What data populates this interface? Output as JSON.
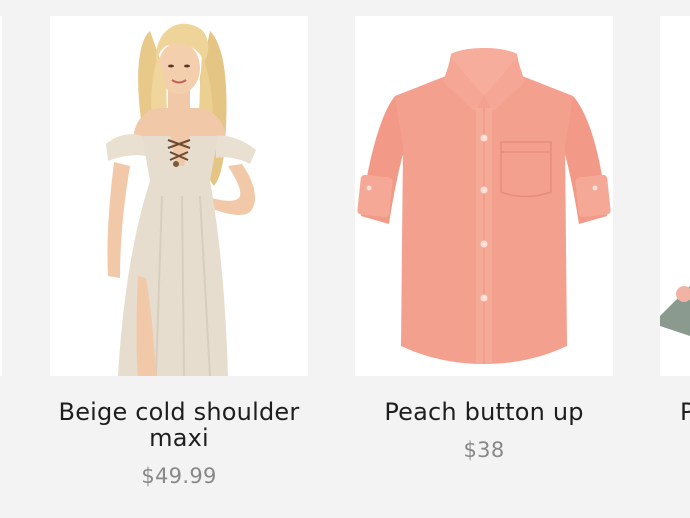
{
  "products": [
    {
      "title": "Beige cold shoulder maxi",
      "price": "$49.99",
      "image_icon": "beige-dress-photo"
    },
    {
      "title": "Peach button up",
      "price": "$38",
      "image_icon": "peach-shirt-photo"
    },
    {
      "title": "P",
      "image_icon": "partial-product-photo"
    }
  ],
  "colors": {
    "page_background": "#f3f3f3",
    "card_background": "#ffffff",
    "title_text": "#1e1e1e",
    "price_text": "#888888",
    "shirt_peach": "#f4a08e",
    "dress_beige": "#e6ddcf"
  }
}
